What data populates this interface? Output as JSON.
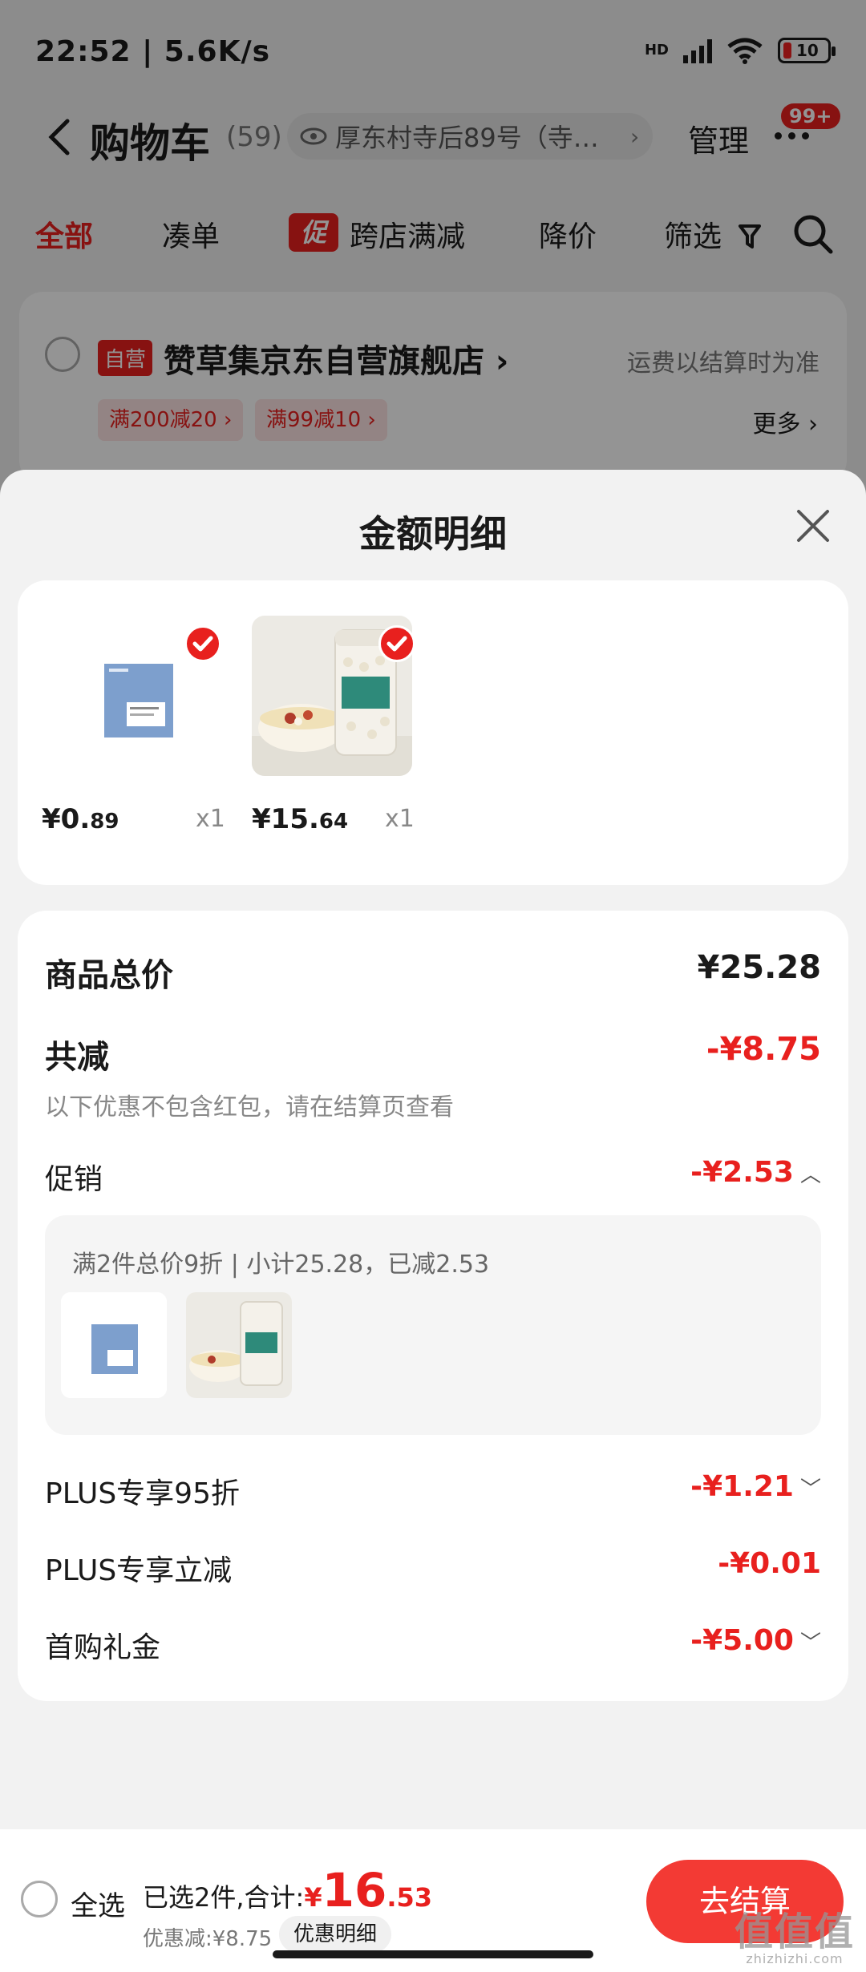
{
  "status_bar": {
    "time": "22:52 | 5.6K/s",
    "net": "HD",
    "battery": "10"
  },
  "nav": {
    "title": "购物车",
    "count": "(59)",
    "address": "厚东村寺后89号（寺…",
    "manage": "管理",
    "badge": "99+"
  },
  "tabs": {
    "all": "全部",
    "combine": "凑单",
    "promo_tag": "促",
    "cross_store": "跨店满减",
    "price_drop": "降价",
    "filter": "筛选"
  },
  "shop": {
    "self_op": "自营",
    "name": "赞草集京东自营旗舰店 ›",
    "shipping": "运费以结算时为准",
    "coupons": [
      "满200减20 ›",
      "满99减10 ›"
    ],
    "more": "更多 ›"
  },
  "sheet": {
    "title": "金额明细",
    "products": [
      {
        "price_int": "¥0.",
        "price_dec": "89",
        "qty": "x1"
      },
      {
        "price_int": "¥15.",
        "price_dec": "64",
        "qty": "x1"
      }
    ],
    "total_label": "商品总价",
    "total_value": "¥25.28",
    "reduce_label": "共减",
    "reduce_value": "-¥8.75",
    "reduce_note": "以下优惠不包含红包，请在结算页查看",
    "promo_label": "促销",
    "promo_value": "-¥2.53",
    "promo_detail": "满2件总价9折 | 小计25.28，已减2.53",
    "plus95_label": "PLUS专享95折",
    "plus95_value": "-¥1.21",
    "plus_reduce_label": "PLUS专享立减",
    "plus_reduce_value": "-¥0.01",
    "first_gift_label": "首购礼金",
    "first_gift_value": "-¥5.00"
  },
  "bottom": {
    "select_all": "全选",
    "selected_text": "已选2件,合计:",
    "currency": "¥",
    "total_int": "16",
    "total_dec": ".53",
    "discount_note": "优惠减:¥8.75",
    "discount_btn": "优惠明细",
    "checkout": "去结算"
  },
  "watermark": {
    "logo": "值值值",
    "url": "zhizhizhi.com"
  },
  "colors": {
    "accent": "#e8201e",
    "checkout": "#f33a34"
  }
}
